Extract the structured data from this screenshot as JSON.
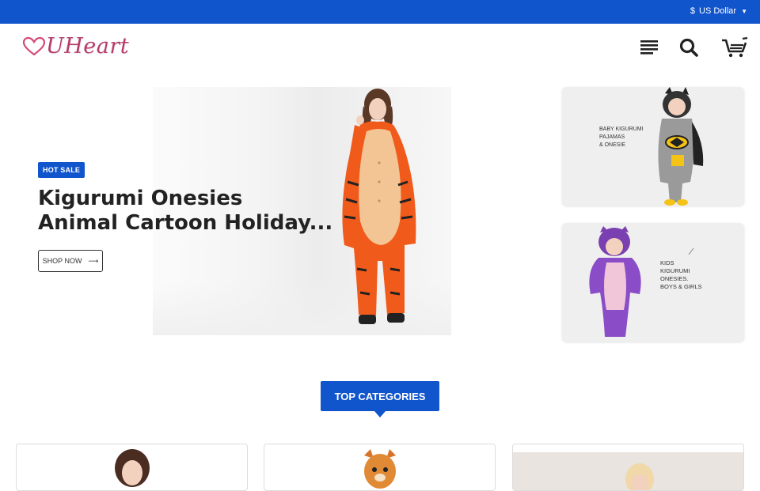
{
  "topbar": {
    "currency_symbol": "$",
    "currency_label": "US Dollar"
  },
  "header": {
    "logo_text": "UHeart",
    "icons": [
      "menu-icon",
      "search-icon",
      "cart-icon"
    ]
  },
  "hero": {
    "badge": "HOT SALE",
    "title_line1": "Kigurumi Onesies",
    "title_line2": "Animal Cartoon Holiday...",
    "cta_label": "SHOP NOW"
  },
  "side_banners": [
    {
      "lines": [
        "BABY KIGURUMI",
        "PAJAMAS",
        "& ONESIE"
      ]
    },
    {
      "lines": [
        "KIDS",
        "KIGURUMI",
        "ONESIES.",
        "BOYS & GIRLS"
      ]
    }
  ],
  "categories": {
    "heading": "TOP CATEGORIES"
  },
  "colors": {
    "accent": "#1155cc",
    "logo": "#b83a6b"
  }
}
